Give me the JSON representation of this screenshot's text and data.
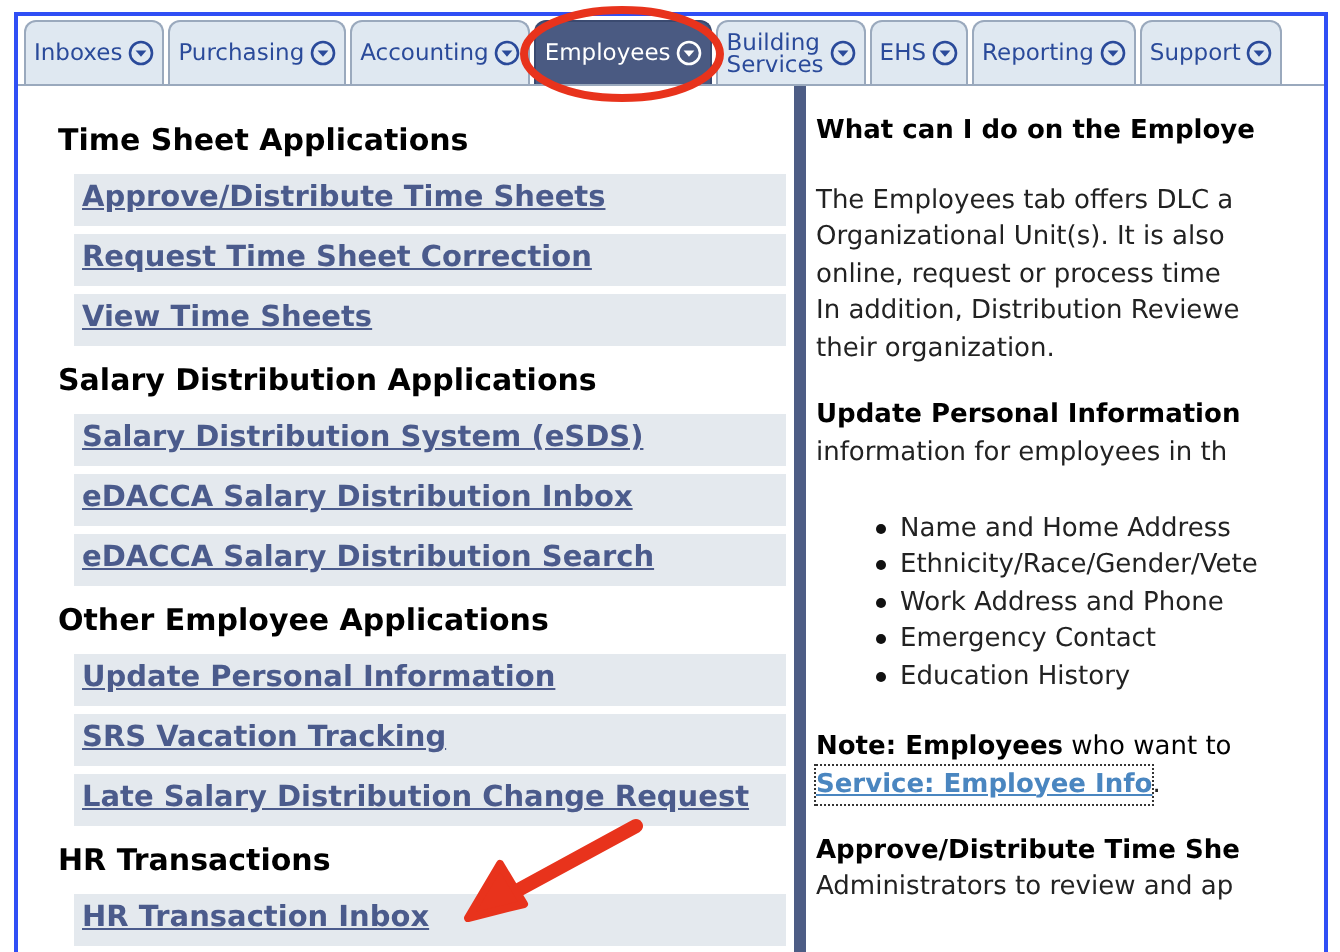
{
  "tabs": [
    {
      "label": "Inboxes",
      "selected": false
    },
    {
      "label": "Purchasing",
      "selected": false
    },
    {
      "label": "Accounting",
      "selected": false
    },
    {
      "label": "Employees",
      "selected": true
    },
    {
      "label": "Building\nServices",
      "selected": false
    },
    {
      "label": "EHS",
      "selected": false
    },
    {
      "label": "Reporting",
      "selected": false
    },
    {
      "label": "Support",
      "selected": false
    }
  ],
  "left_panel": {
    "sections": [
      {
        "heading": "Time Sheet Applications",
        "links": [
          "Approve/Distribute Time Sheets",
          "Request Time Sheet Correction",
          "View Time Sheets"
        ]
      },
      {
        "heading": "Salary Distribution Applications",
        "links": [
          "Salary Distribution System (eSDS)",
          "eDACCA Salary Distribution Inbox",
          "eDACCA Salary Distribution Search"
        ]
      },
      {
        "heading": "Other Employee Applications",
        "links": [
          "Update Personal Information",
          "SRS Vacation Tracking",
          "Late Salary Distribution Change Request"
        ]
      },
      {
        "heading": "HR Transactions",
        "links": [
          "HR Transaction Inbox"
        ]
      }
    ]
  },
  "right_panel": {
    "heading": "What can I do on the Employe",
    "intro_lines": [
      "The Employees tab offers DLC a",
      "Organizational Unit(s). It is also",
      "online, request or process time",
      "In addition, Distribution Reviewe",
      "their organization."
    ],
    "update_heading": "Update Personal Information",
    "update_lines": [
      "information for employees in th"
    ],
    "bullets": [
      "Name and Home Address",
      "Ethnicity/Race/Gender/Vete",
      "Work Address and Phone",
      "Emergency Contact",
      "Education History"
    ],
    "note_line": "**Note: Employees** who want to",
    "note_link": "Service: Employee Info",
    "note_end": ".",
    "approve_heading": "Approve/Distribute Time She",
    "approve_lines": [
      "Administrators to review and ap"
    ]
  }
}
